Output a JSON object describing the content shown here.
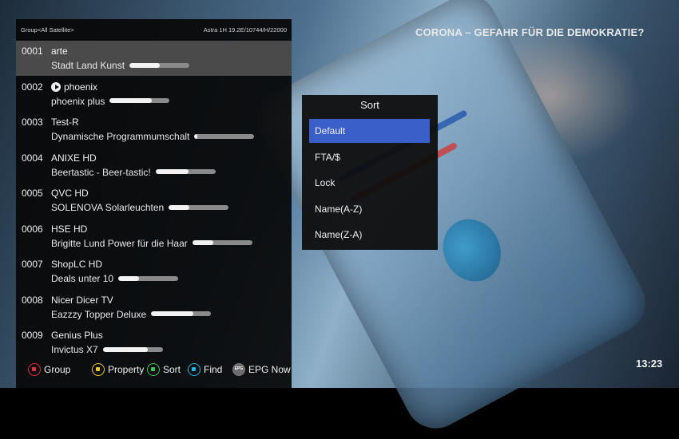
{
  "video": {
    "headline": "CORONA – GEFAHR FÜR DIE DEMOKRATIE?",
    "clock": "13:23"
  },
  "info_bar": {
    "group": "Group<All Satellite>",
    "satellite": "Astra 1H 19.2E/10744/H/22000"
  },
  "channels": [
    {
      "number": "0001",
      "name": "arte",
      "program": "Stadt Land Kunst",
      "progress": 0.5,
      "selected": true,
      "icon": null
    },
    {
      "number": "0002",
      "name": "phoenix",
      "program": "phoenix plus",
      "progress": 0.7,
      "selected": false,
      "icon": "play-circle-icon"
    },
    {
      "number": "0003",
      "name": "Test-R",
      "program": "Dynamische Programmumschalt",
      "progress": 0.05,
      "selected": false,
      "icon": null
    },
    {
      "number": "0004",
      "name": "ANIXE HD",
      "program": "Beertastic - Beer-tastic!",
      "progress": 0.55,
      "selected": false,
      "icon": null
    },
    {
      "number": "0005",
      "name": "QVC HD",
      "program": "SOLENOVA Solarleuchten",
      "progress": 0.35,
      "selected": false,
      "icon": null
    },
    {
      "number": "0006",
      "name": "HSE HD",
      "program": "Brigitte Lund Power für die Haar",
      "progress": 0.35,
      "selected": false,
      "icon": null
    },
    {
      "number": "0007",
      "name": "ShopLC HD",
      "program": "Deals unter 10",
      "progress": 0.35,
      "selected": false,
      "icon": null
    },
    {
      "number": "0008",
      "name": "Nicer Dicer TV",
      "program": "Eazzzy Topper Deluxe",
      "progress": 0.7,
      "selected": false,
      "icon": null
    },
    {
      "number": "0009",
      "name": "Genius Plus",
      "program": "Invictus X7",
      "progress": 0.75,
      "selected": false,
      "icon": null
    }
  ],
  "legend": [
    {
      "key": "red",
      "label": "Group"
    },
    {
      "key": "yellow",
      "label": "Property"
    },
    {
      "key": "green",
      "label": "Sort"
    },
    {
      "key": "blue",
      "label": "Find"
    },
    {
      "key": "epg",
      "key_text": "EPG",
      "label": "EPG Now"
    }
  ],
  "sort_popup": {
    "title": "Sort",
    "options": [
      "Default",
      "FTA/$",
      "Lock",
      "Name(A-Z)",
      "Name(Z-A)"
    ],
    "selected_index": 0
  },
  "colors": {
    "selection": "#4a4a4a",
    "sort_highlight": "#3a5fc8",
    "key_red": "#d8323c",
    "key_yellow": "#f1c531",
    "key_green": "#39c556",
    "key_blue": "#2bb5e3"
  }
}
